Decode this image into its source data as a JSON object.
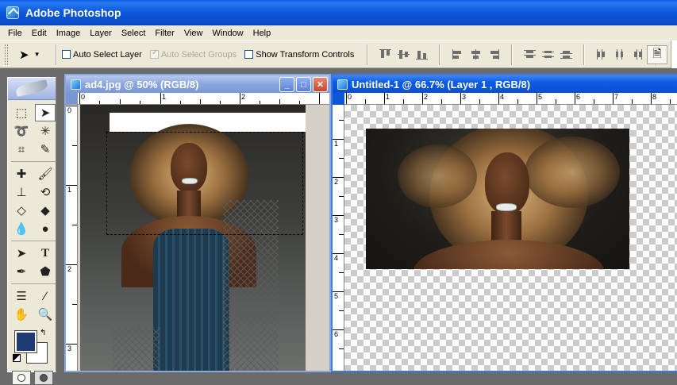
{
  "app": {
    "title": "Adobe Photoshop"
  },
  "menu": [
    "File",
    "Edit",
    "Image",
    "Layer",
    "Select",
    "Filter",
    "View",
    "Window",
    "Help"
  ],
  "options": {
    "auto_select_layer": "Auto Select Layer",
    "auto_select_groups": "Auto Select Groups",
    "show_transform_controls": "Show Transform Controls"
  },
  "toolbox": {
    "foreground_color": "#1f3b73",
    "background_color": "#ffffff"
  },
  "doc1": {
    "title": "ad4.jpg @ 50% (RGB/8)",
    "ruler_h": [
      "0",
      "1",
      "2"
    ],
    "ruler_v": [
      "0",
      "1",
      "2",
      "3"
    ]
  },
  "doc2": {
    "title": "Untitled-1 @ 66.7% (Layer 1 , RGB/8)",
    "ruler_h": [
      "0",
      "1",
      "2",
      "3",
      "4",
      "5",
      "6",
      "7",
      "8"
    ],
    "ruler_v": [
      "1",
      "2",
      "3",
      "4",
      "5",
      "6"
    ]
  },
  "window_buttons": {
    "minimize": "_",
    "maximize": "□",
    "close": "✕"
  }
}
